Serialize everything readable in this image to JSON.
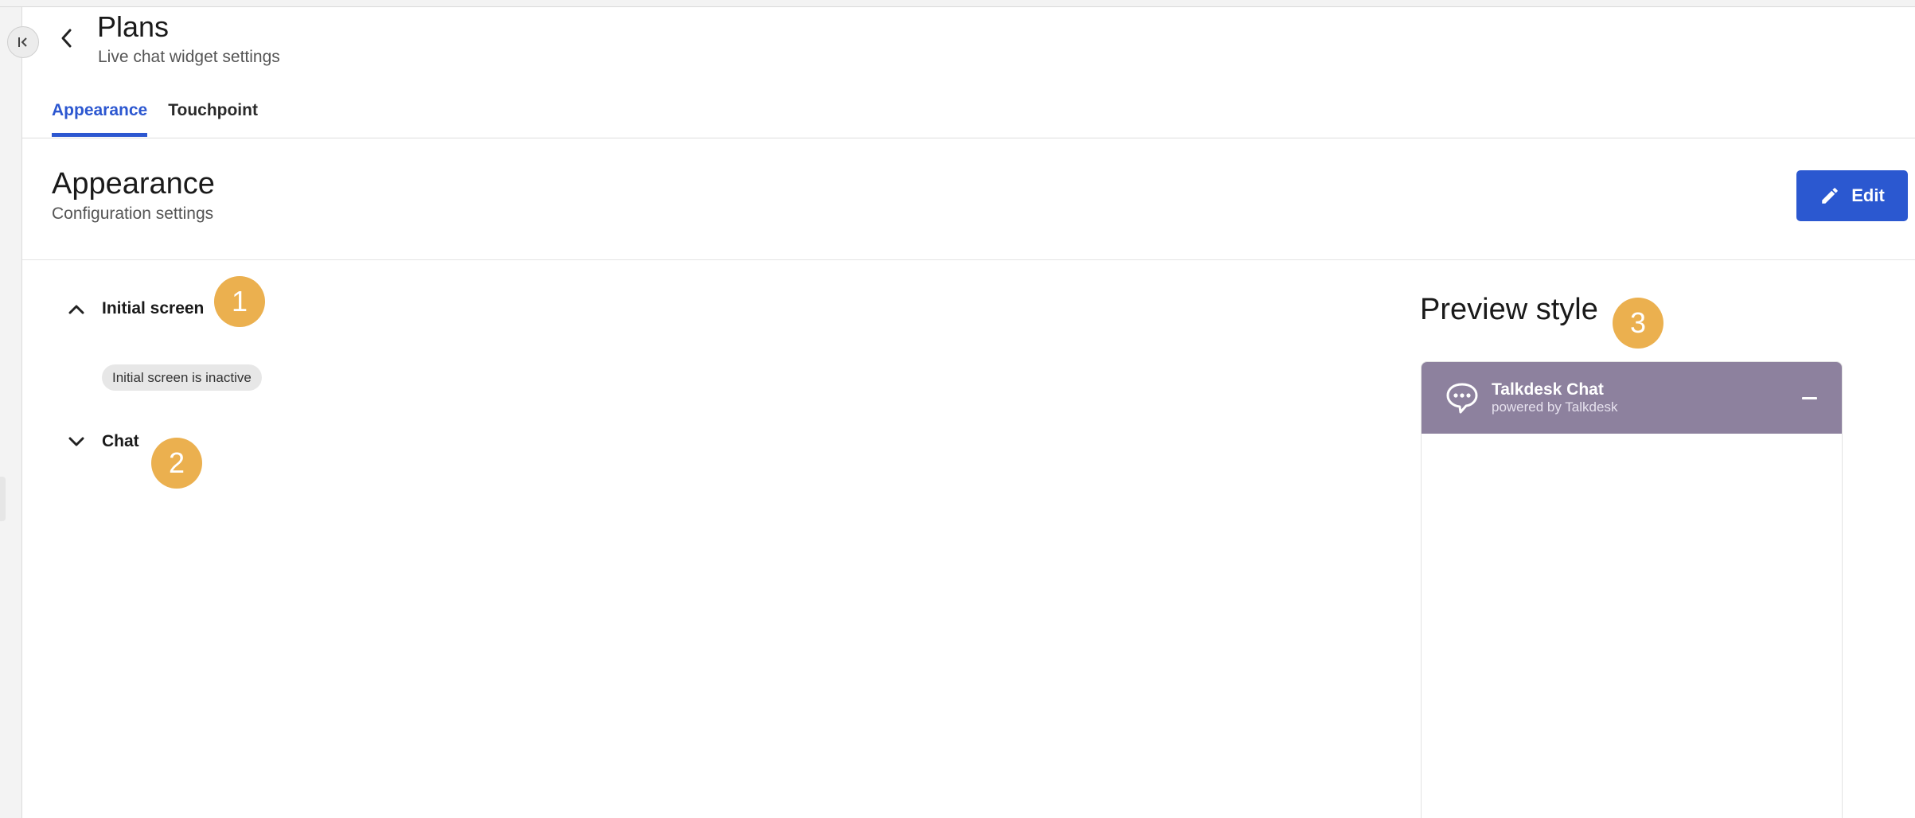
{
  "header": {
    "title": "Plans",
    "subtitle": "Live chat widget settings"
  },
  "tabs": [
    {
      "label": "Appearance",
      "active": true
    },
    {
      "label": "Touchpoint",
      "active": false
    }
  ],
  "section": {
    "title": "Appearance",
    "subtitle": "Configuration settings",
    "edit_label": "Edit"
  },
  "accordion": {
    "initial_screen": {
      "label": "Initial screen",
      "expanded": true,
      "status_badge": "Initial screen is inactive"
    },
    "chat": {
      "label": "Chat",
      "expanded": false
    }
  },
  "markers": [
    "1",
    "2",
    "3"
  ],
  "preview": {
    "title": "Preview style",
    "widget_name": "Talkdesk Chat",
    "powered_by": "powered by Talkdesk",
    "header_color": "#8d819e"
  },
  "colors": {
    "accent": "#2b58d0",
    "marker": "#ebb04f"
  },
  "icons": {
    "collapse": "collapse-sidebar-icon",
    "back": "chevron-left-icon",
    "edit": "pencil-icon",
    "expand": "chevron-up-icon",
    "collapse_section": "chevron-down-icon",
    "chat": "chat-bubble-icon",
    "minimize": "minimize-icon"
  }
}
